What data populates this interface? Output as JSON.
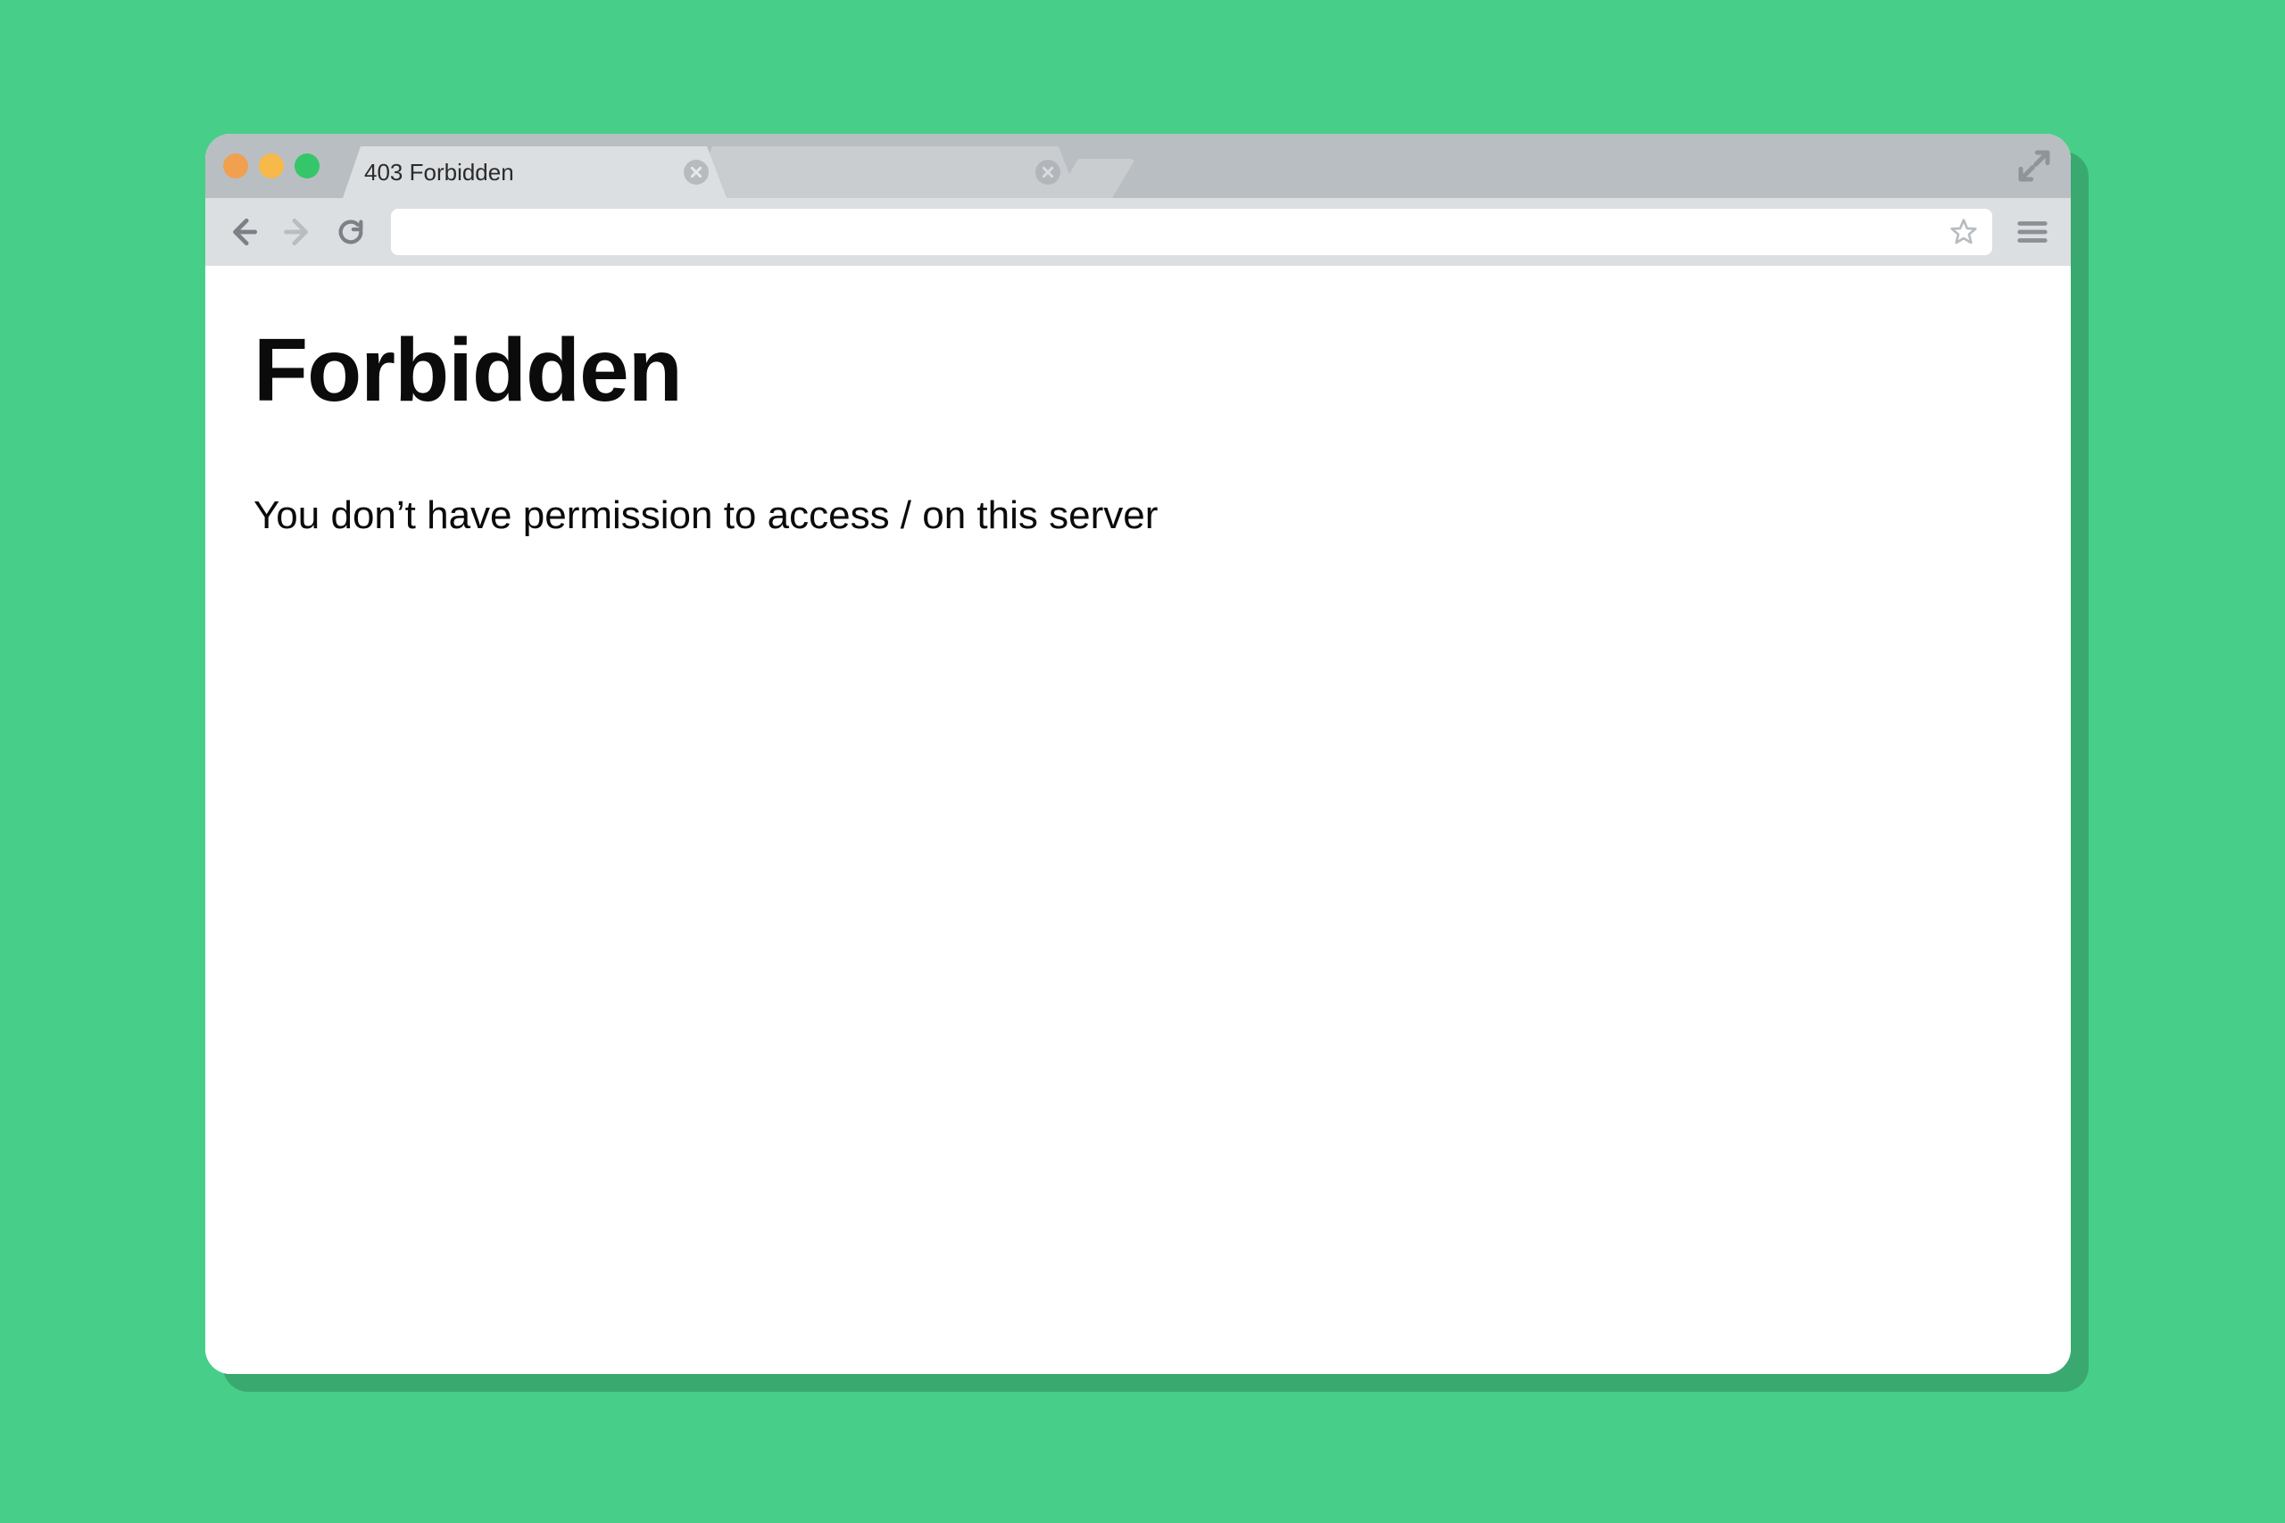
{
  "window": {
    "traffic_lights": [
      "close",
      "minimize",
      "zoom"
    ]
  },
  "tabs": {
    "active": {
      "title": "403 Forbidden"
    },
    "inactive": {
      "title": ""
    }
  },
  "toolbar": {
    "back_enabled": true,
    "forward_enabled": false,
    "address_value": ""
  },
  "page": {
    "heading": "Forbidden",
    "message": "You don’t have permission to access / on this server"
  }
}
